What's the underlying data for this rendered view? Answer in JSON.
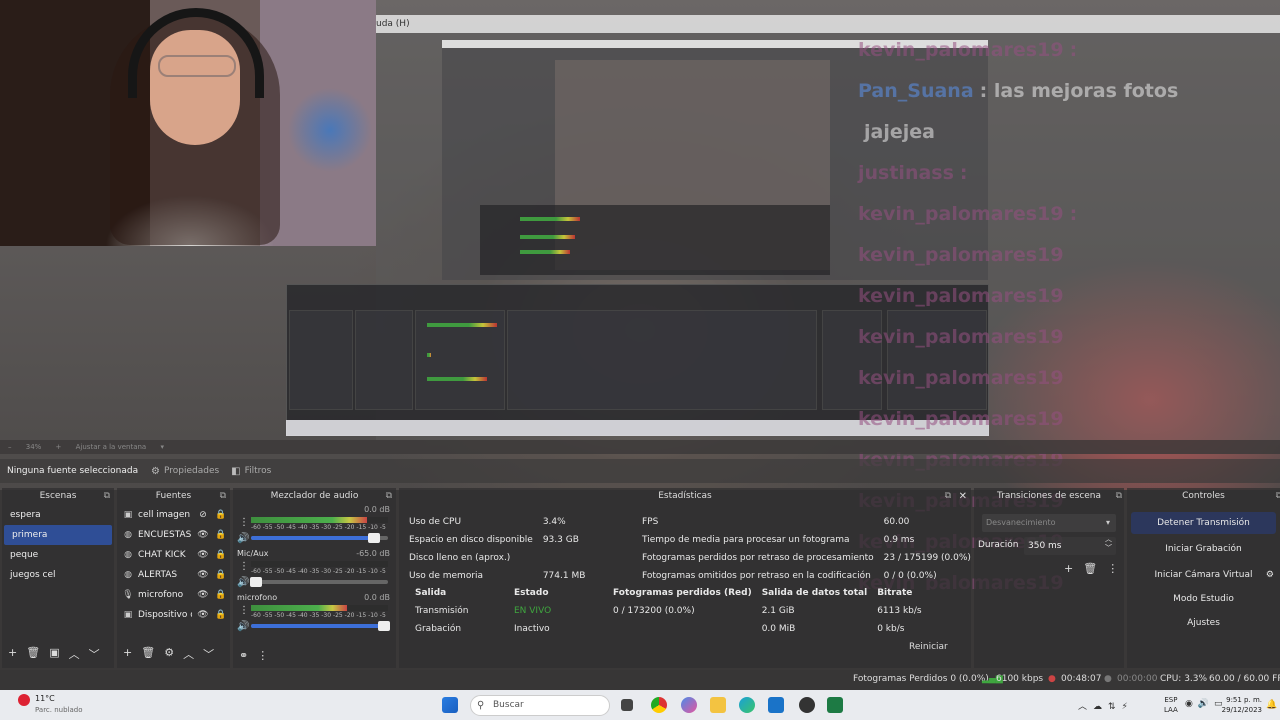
{
  "preview": {
    "nested_title": "uda (H)",
    "zoom_label": "34%",
    "zoom_fit": "Ajustar a la ventana",
    "chat": [
      {
        "user": "kevin_palomares19",
        "text": ":"
      },
      {
        "user": "Pan_Suana",
        "text": ": las mejoras fotos"
      },
      {
        "user": "",
        "text": "jajejea"
      },
      {
        "user": "justinass",
        "text": ":"
      },
      {
        "user": "kevin_palomares19",
        "text": ":"
      },
      {
        "user": "kevin_palomares19",
        "text": ""
      },
      {
        "user": "kevin_palomares19",
        "text": ""
      },
      {
        "user": "kevin_palomares19",
        "text": ""
      },
      {
        "user": "kevin_palomares19",
        "text": ""
      },
      {
        "user": "kevin_palomares19",
        "text": ""
      },
      {
        "user": "kevin_palomares19",
        "text": ""
      },
      {
        "user": "kevin_palomares19",
        "text": ""
      },
      {
        "user": "kevin_palomares19",
        "text": ""
      },
      {
        "user": "kevin_palomares19",
        "text": ""
      }
    ]
  },
  "context_bar": {
    "no_source": "Ninguna fuente seleccionada",
    "properties": "Propiedades",
    "filters": "Filtros"
  },
  "scenes": {
    "title": "Escenas",
    "items": [
      "espera",
      "primera",
      "peque",
      "juegos cel"
    ],
    "selected": 1
  },
  "sources": {
    "title": "Fuentes",
    "items": [
      {
        "name": "cell imagen",
        "icon": "image-icon",
        "visible": false
      },
      {
        "name": "ENCUESTAS I",
        "icon": "browser-icon",
        "visible": true
      },
      {
        "name": "CHAT KICK",
        "icon": "browser-icon",
        "visible": true
      },
      {
        "name": "ALERTAS",
        "icon": "browser-icon",
        "visible": true
      },
      {
        "name": "microfono",
        "icon": "mic-icon",
        "visible": true
      },
      {
        "name": "Dispositivo d",
        "icon": "camera-icon",
        "visible": true
      }
    ]
  },
  "mixer": {
    "title": "Mezclador de audio",
    "ticks": "-60 -55 -50 -45 -40 -35 -30 -25 -20 -15 -10 -5 0",
    "channels": [
      {
        "name": "",
        "db": "0.0 dB",
        "level": 0.85,
        "volume": 0.9
      },
      {
        "name": "Mic/Aux",
        "db": "-65.0 dB",
        "level": 0.0,
        "volume": 0.04
      },
      {
        "name": "microfono",
        "db": "0.0 dB",
        "level": 0.7,
        "volume": 0.97
      }
    ]
  },
  "stats": {
    "title": "Estadísticas",
    "left": [
      {
        "label": "Uso de CPU",
        "value": "3.4%"
      },
      {
        "label": "Espacio en disco disponible",
        "value": "93.3 GB"
      },
      {
        "label": "Disco lleno en (aprox.)",
        "value": ""
      },
      {
        "label": "Uso de memoria",
        "value": "774.1 MB"
      }
    ],
    "right": [
      {
        "label": "FPS",
        "value": "60.00"
      },
      {
        "label": "Tiempo de media para procesar un fotograma",
        "value": "0.9 ms"
      },
      {
        "label": "Fotogramas perdidos por retraso de procesamiento",
        "value": "23 / 175199 (0.0%)"
      },
      {
        "label": "Fotogramas omitidos por retraso en la codificación",
        "value": "0 / 0 (0.0%)"
      }
    ],
    "output_headers": [
      "Salida",
      "Estado",
      "Fotogramas perdidos (Red)",
      "Salida de datos total",
      "Bitrate"
    ],
    "outputs": [
      {
        "name": "Transmisión",
        "status": "EN VIVO",
        "dropped": "0 / 173200 (0.0%)",
        "total": "2.1 GiB",
        "bitrate": "6113 kb/s"
      },
      {
        "name": "Grabación",
        "status": "Inactivo",
        "dropped": "",
        "total": "0.0 MiB",
        "bitrate": "0 kb/s"
      }
    ],
    "reset": "Reiniciar"
  },
  "transitions": {
    "title": "Transiciones de escena",
    "selected": "Desvanecimiento",
    "duration_label": "Duración",
    "duration_value": "350 ms"
  },
  "controls": {
    "title": "Controles",
    "buttons": [
      "Detener Transmisión",
      "Iniciar Grabación",
      "Iniciar Cámara Virtual",
      "Modo Estudio",
      "Ajustes"
    ]
  },
  "status_bar": {
    "dropped": "Fotogramas Perdidos 0 (0.0%)",
    "bitrate": "6100 kbps",
    "live_time": "00:48:07",
    "rec_time": "00:00:00",
    "cpu": "CPU: 3.3%",
    "fps": "60.00 / 60.00 FPS"
  },
  "taskbar": {
    "weather_temp": "11°C",
    "weather_desc": "Parc. nublado",
    "search": "Buscar",
    "lang1": "ESP",
    "lang2": "LAA",
    "time": "9:51 p. m.",
    "date": "29/12/2023"
  }
}
